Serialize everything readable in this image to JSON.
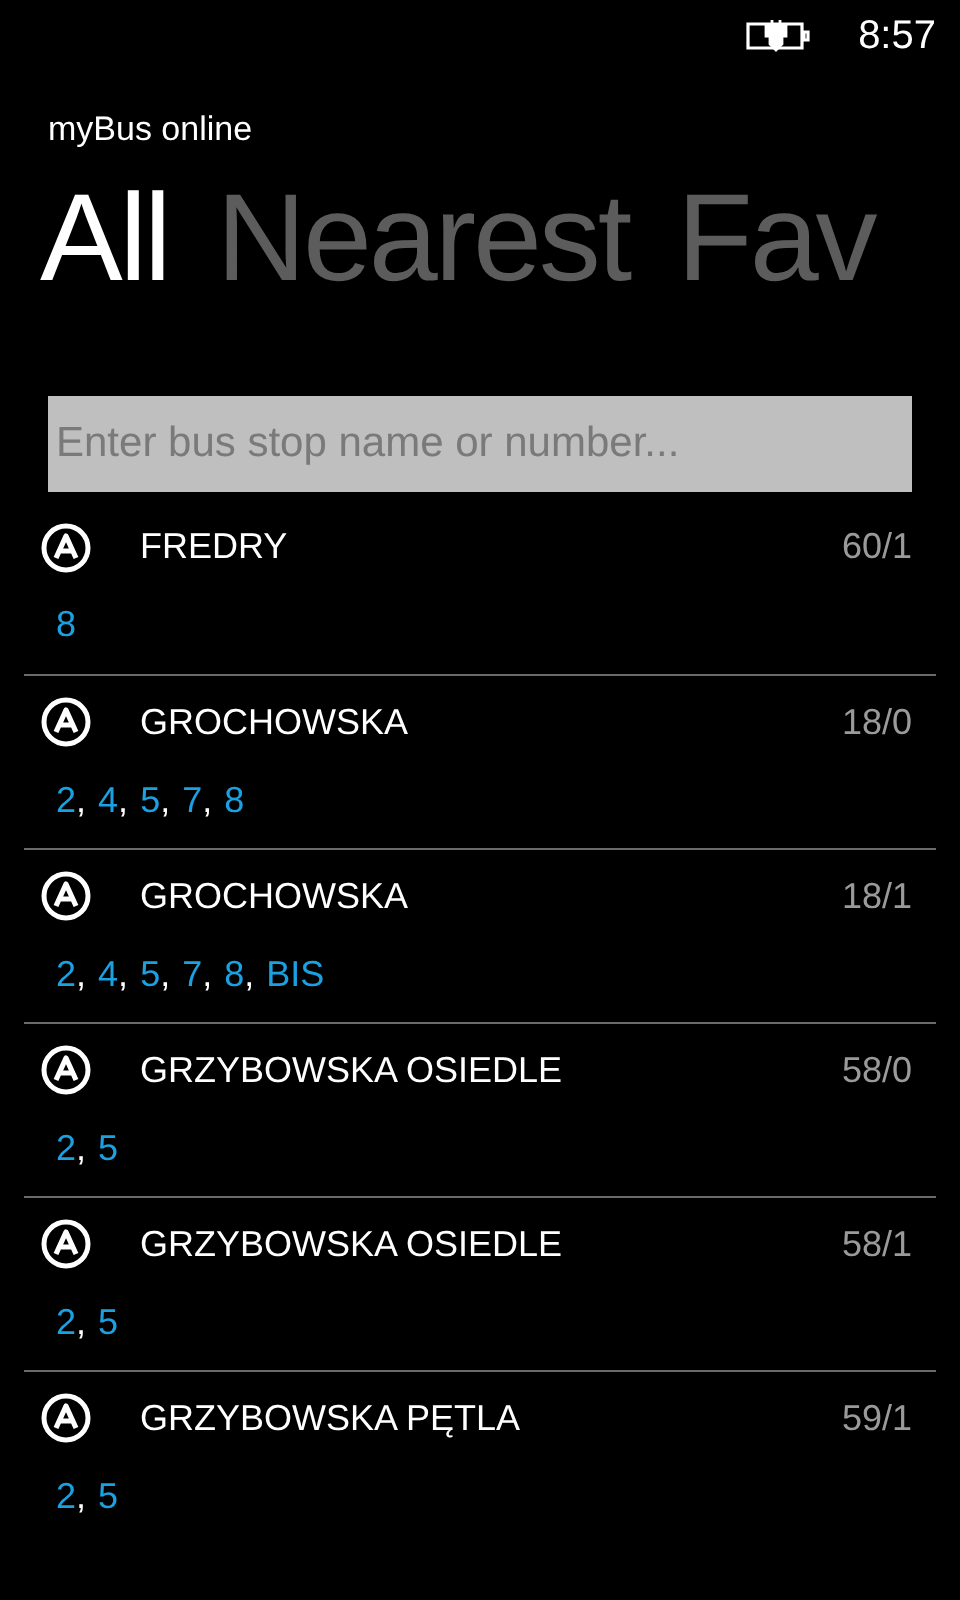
{
  "status_bar": {
    "time": "8:57"
  },
  "app_title": "myBus online",
  "tabs": [
    {
      "label": "All",
      "selected": true
    },
    {
      "label": "Nearest",
      "selected": false
    },
    {
      "label": "Fav",
      "selected": false
    }
  ],
  "search": {
    "placeholder": "Enter bus stop name or number..."
  },
  "route_separator": ",",
  "stops": [
    {
      "name": "FREDRY",
      "number": "60/1",
      "routes": [
        "8"
      ]
    },
    {
      "name": "GROCHOWSKA",
      "number": "18/0",
      "routes": [
        "2",
        "4",
        "5",
        "7",
        "8"
      ]
    },
    {
      "name": "GROCHOWSKA",
      "number": "18/1",
      "routes": [
        "2",
        "4",
        "5",
        "7",
        "8",
        "BIS"
      ]
    },
    {
      "name": "GRZYBOWSKA OSIEDLE",
      "number": "58/0",
      "routes": [
        "2",
        "5"
      ]
    },
    {
      "name": "GRZYBOWSKA OSIEDLE",
      "number": "58/1",
      "routes": [
        "2",
        "5"
      ]
    },
    {
      "name": "GRZYBOWSKA PĘTLA",
      "number": "59/1",
      "routes": [
        "2",
        "5"
      ]
    }
  ]
}
